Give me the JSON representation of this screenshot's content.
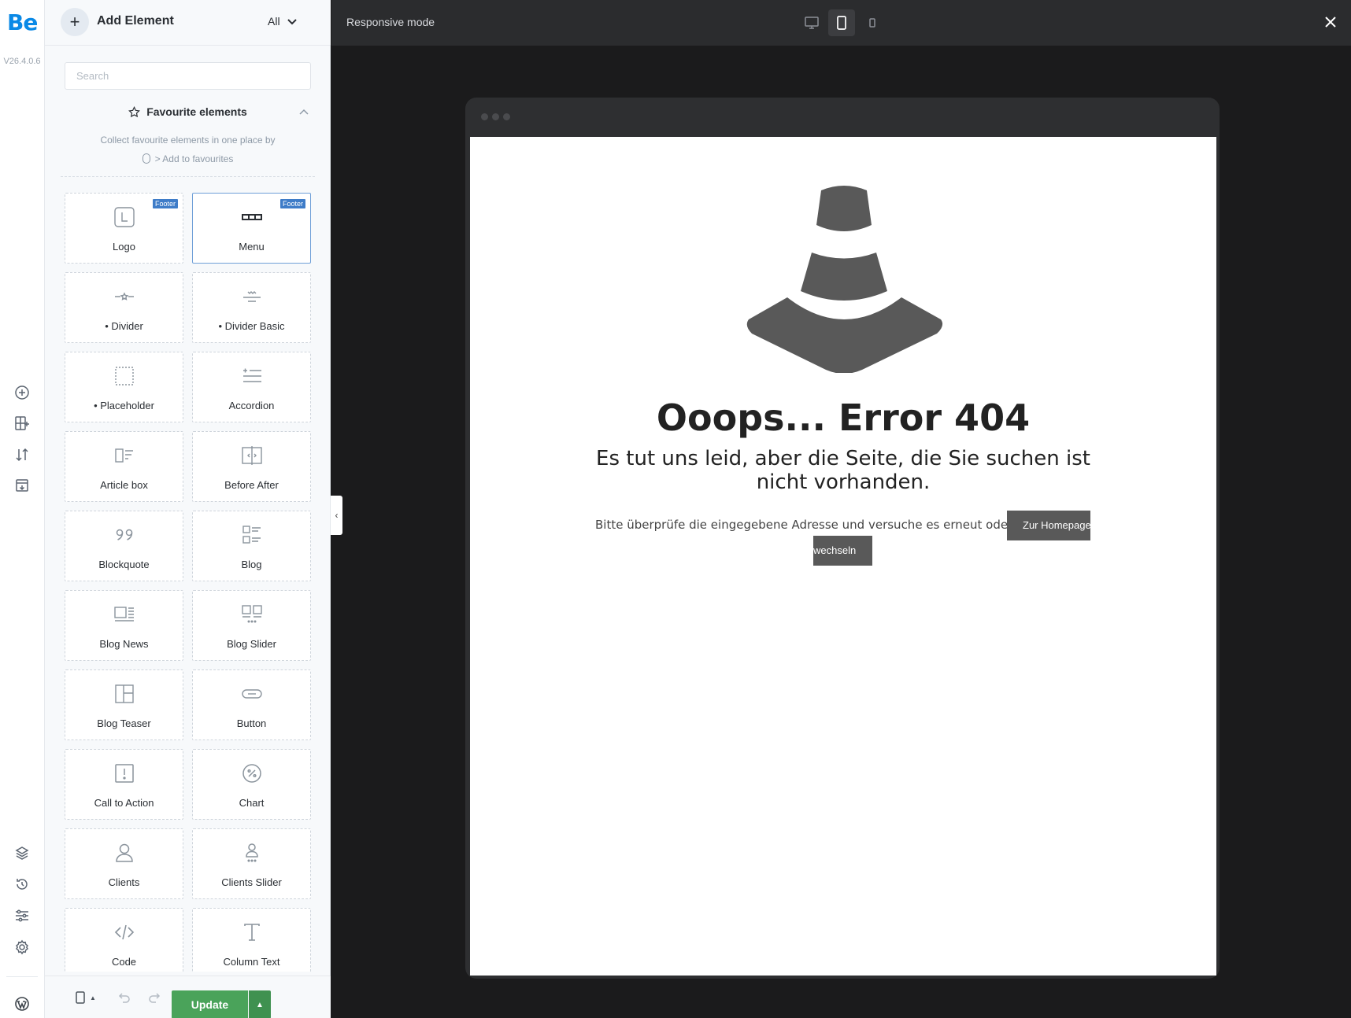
{
  "rail": {
    "logo": "Be",
    "version": "V26.4.0.6"
  },
  "panel": {
    "title": "Add Element",
    "filter": "All",
    "search_placeholder": "Search",
    "favourites": {
      "title": "Favourite elements",
      "desc_line1": "Collect favourite elements in one place by",
      "desc_line2": "> Add to favourites"
    },
    "elements": [
      {
        "label": "Logo",
        "badge": "Footer",
        "icon": "logo-icon"
      },
      {
        "label": "Menu",
        "badge": "Footer",
        "icon": "menu-icon"
      },
      {
        "label": "• Divider",
        "icon": "divider-icon"
      },
      {
        "label": "• Divider Basic",
        "icon": "divider-basic-icon"
      },
      {
        "label": "• Placeholder",
        "icon": "placeholder-icon"
      },
      {
        "label": "Accordion",
        "icon": "accordion-icon"
      },
      {
        "label": "Article box",
        "icon": "article-box-icon"
      },
      {
        "label": "Before After",
        "icon": "before-after-icon"
      },
      {
        "label": "Blockquote",
        "icon": "blockquote-icon"
      },
      {
        "label": "Blog",
        "icon": "blog-icon"
      },
      {
        "label": "Blog News",
        "icon": "blog-news-icon"
      },
      {
        "label": "Blog Slider",
        "icon": "blog-slider-icon"
      },
      {
        "label": "Blog Teaser",
        "icon": "blog-teaser-icon"
      },
      {
        "label": "Button",
        "icon": "button-icon"
      },
      {
        "label": "Call to Action",
        "icon": "call-to-action-icon"
      },
      {
        "label": "Chart",
        "icon": "chart-icon"
      },
      {
        "label": "Clients",
        "icon": "clients-icon"
      },
      {
        "label": "Clients Slider",
        "icon": "clients-slider-icon"
      },
      {
        "label": "Code",
        "icon": "code-icon"
      },
      {
        "label": "Column Text",
        "icon": "column-text-icon"
      }
    ],
    "footer": {
      "update": "Update"
    }
  },
  "topbar": {
    "title": "Responsive mode",
    "active_device": "tablet"
  },
  "preview": {
    "title": "Ooops... Error 404",
    "subtitle": "Es tut uns leid, aber die Seite, die Sie suchen ist nicht vorhanden.",
    "text": "Bitte überprüfe die eingegebene Adresse und versuche es erneut oder",
    "button_part1": "Zur Homepage",
    "button_part2": "wechseln"
  },
  "colors": {
    "brand": "#0a89e6",
    "update": "#4aa35a",
    "badge": "#3e7cc8",
    "cone": "#595959"
  }
}
